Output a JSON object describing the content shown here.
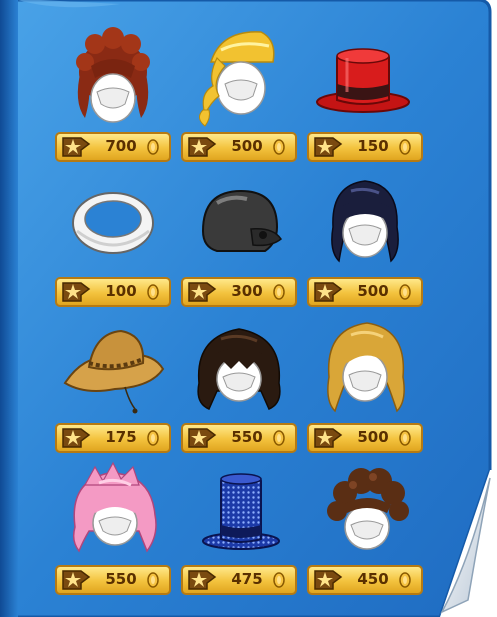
{
  "catalog": {
    "items": [
      {
        "icon": "red-curly-updo-hair-icon",
        "price": "700"
      },
      {
        "icon": "blonde-side-ponytail-hair-icon",
        "price": "500"
      },
      {
        "icon": "red-top-hat-icon",
        "price": "150"
      },
      {
        "icon": "white-fuzzy-headband-icon",
        "price": "100"
      },
      {
        "icon": "black-batting-helmet-icon",
        "price": "300"
      },
      {
        "icon": "navy-long-hair-icon",
        "price": "500"
      },
      {
        "icon": "tan-safari-hat-icon",
        "price": "175"
      },
      {
        "icon": "dark-brown-shaggy-hair-icon",
        "price": "550"
      },
      {
        "icon": "golden-long-wavy-hair-icon",
        "price": "500"
      },
      {
        "icon": "pink-spiky-hair-icon",
        "price": "550"
      },
      {
        "icon": "blue-sequin-top-hat-icon",
        "price": "475"
      },
      {
        "icon": "brown-curly-hair-icon",
        "price": "450"
      }
    ],
    "colors": {
      "page_blue": "#2b7fd0",
      "price_gold": "#f3c23d",
      "price_text": "#5a3000"
    }
  }
}
